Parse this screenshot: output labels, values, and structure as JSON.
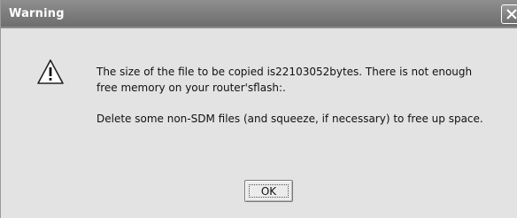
{
  "dialog": {
    "title": "Warning",
    "icon": "warning-triangle-icon",
    "message_line1": "The size of the file to be copied is22103052bytes. There is not enough",
    "message_line2": "free memory on your router'sflash:.",
    "message_line3": "Delete some non-SDM files (and squeeze, if necessary) to free up space.",
    "ok_label": "OK",
    "close_icon": "close-icon"
  },
  "colors": {
    "titlebar": "#7f7f7f",
    "body": "#e3e3e3",
    "title_text": "#ffffff"
  }
}
